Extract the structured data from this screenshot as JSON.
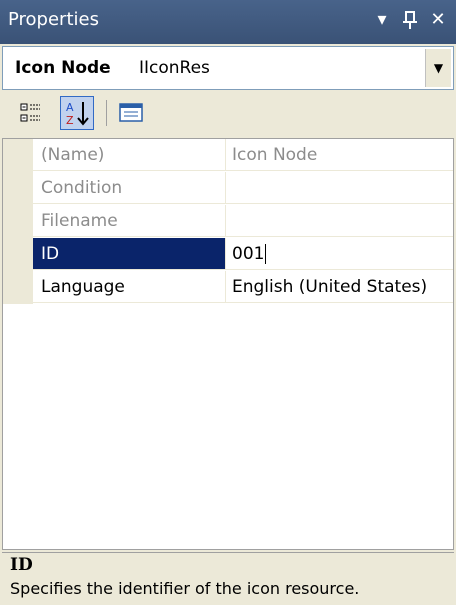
{
  "titlebar": {
    "title": "Properties",
    "dropdown_glyph": "▾",
    "pin_glyph": "ᴘ",
    "close_glyph": "✕"
  },
  "object_selector": {
    "name": "Icon Node",
    "type": "IIconRes",
    "drop_glyph": "▼"
  },
  "toolbar": {
    "buttons": [
      {
        "icon": "categorized-icon",
        "active": false
      },
      {
        "icon": "alphabetical-icon",
        "active": true
      },
      {
        "icon": "property-pages-icon",
        "active": false
      }
    ]
  },
  "grid": {
    "rows": [
      {
        "name": "(Name)",
        "value": "Icon Node",
        "state": "disabled"
      },
      {
        "name": "Condition",
        "value": "",
        "state": "disabled"
      },
      {
        "name": "Filename",
        "value": "",
        "state": "disabled"
      },
      {
        "name": "ID",
        "value": "001",
        "state": "selected"
      },
      {
        "name": "Language",
        "value": "English (United States)",
        "state": "normal"
      }
    ]
  },
  "description": {
    "title": "ID",
    "text": "Specifies the identifier of the icon resource."
  },
  "colors": {
    "titlebar": "#3f5a80",
    "selection": "#0a246a",
    "panel": "#ece9d8"
  }
}
